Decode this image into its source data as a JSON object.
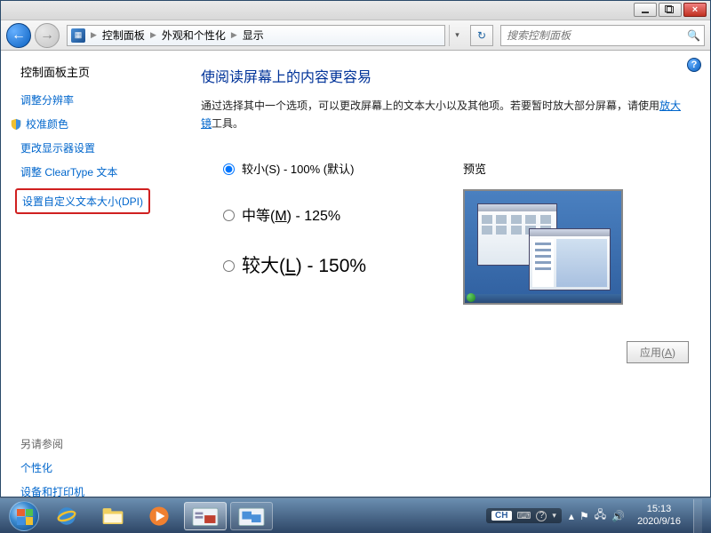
{
  "window_controls": {
    "min": "minimize",
    "max": "restore",
    "close": "close"
  },
  "breadcrumb": {
    "root": "控制面板",
    "mid": "外观和个性化",
    "leaf": "显示"
  },
  "search": {
    "placeholder": "搜索控制面板"
  },
  "sidebar": {
    "home": "控制面板主页",
    "links": [
      "调整分辨率",
      "校准颜色",
      "更改显示器设置",
      "调整 ClearType 文本",
      "设置自定义文本大小(DPI)"
    ],
    "seealso_header": "另请参阅",
    "seealso": [
      "个性化",
      "设备和打印机"
    ]
  },
  "heading": "使阅读屏幕上的内容更容易",
  "desc_prefix": "通过选择其中一个选项，可以更改屏幕上的文本大小以及其他项。若要暂时放大部分屏幕，请使用",
  "desc_link": "放大镜",
  "desc_suffix": "工具。",
  "options": {
    "small": "较小(S) - 100% (默认)",
    "mid_prefix": "中等(",
    "mid_u": "M",
    "mid_suffix": ") - 125%",
    "large_prefix": "较大(",
    "large_u": "L",
    "large_suffix": ") - 150%"
  },
  "preview_label": "预览",
  "apply_prefix": "应用(",
  "apply_u": "A",
  "apply_suffix": ")",
  "taskbar": {
    "lang": "CH",
    "time": "15:13",
    "date": "2020/9/16"
  }
}
